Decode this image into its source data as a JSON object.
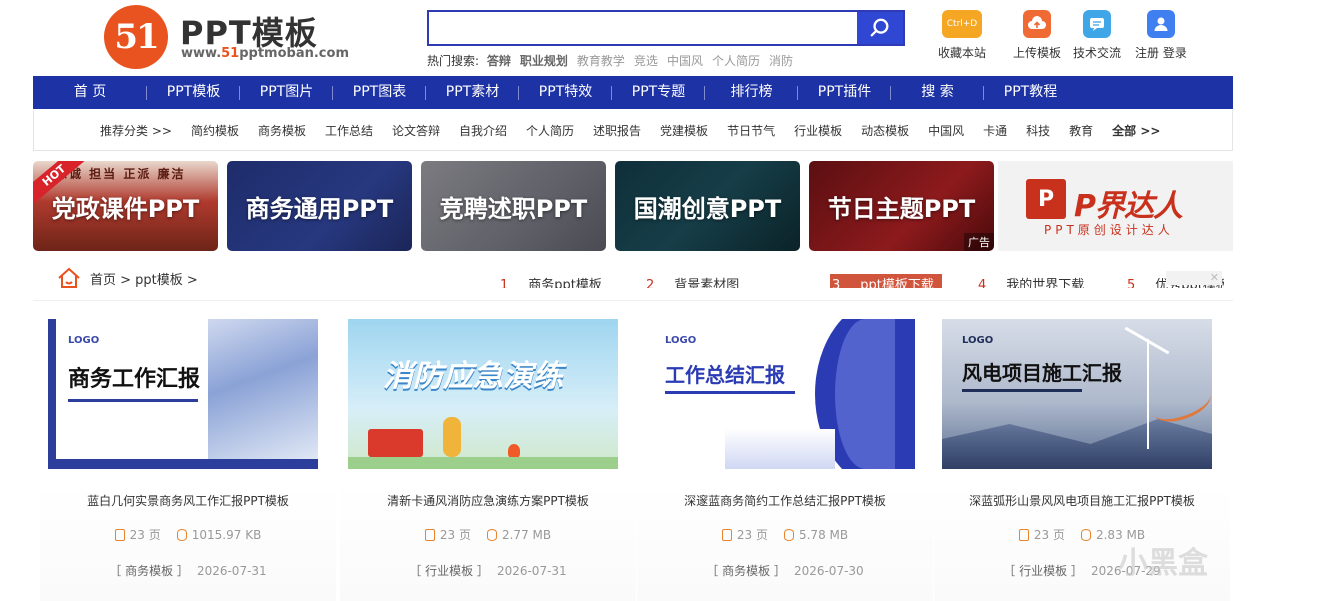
{
  "header": {
    "logo_mark": "51",
    "logo_title": "PPT模板",
    "logo_url_prefix": "www.",
    "logo_url_num": "51",
    "logo_url_suffix": "pptmoban.com",
    "search": {
      "value": "",
      "placeholder": ""
    },
    "hot_label": "热门搜索:",
    "hot_items": [
      {
        "text": "答辩",
        "bold": true
      },
      {
        "text": "职业规划",
        "bold": true
      },
      {
        "text": "教育教学",
        "bold": false
      },
      {
        "text": "竞选",
        "bold": false
      },
      {
        "text": "中国风",
        "bold": false
      },
      {
        "text": "个人简历",
        "bold": false
      },
      {
        "text": "消防",
        "bold": false
      }
    ],
    "top_icons": [
      {
        "label": "收藏本站",
        "icon": "bookmark-icon",
        "glyph": "Ctrl+D",
        "color": "#f5a623"
      },
      {
        "label": "上传模板",
        "icon": "upload-cloud-icon",
        "glyph": "",
        "color": "#f06a35"
      },
      {
        "label": "技术交流",
        "icon": "chat-icon",
        "glyph": "",
        "color": "#3fa6e8"
      },
      {
        "label": "注册 登录",
        "icon": "user-icon",
        "glyph": "",
        "color": "#3f7ff0"
      }
    ]
  },
  "nav": [
    "首 页",
    "PPT模板",
    "PPT图片",
    "PPT图表",
    "PPT素材",
    "PPT特效",
    "PPT专题",
    "排行榜",
    "PPT插件",
    "搜 索",
    "PPT教程"
  ],
  "categories": {
    "label": "推荐分类 >>",
    "items": [
      "简约模板",
      "商务模板",
      "工作总结",
      "论文答辩",
      "自我介绍",
      "个人简历",
      "述职报告",
      "党建模板",
      "节日节气",
      "行业模板",
      "动态模板",
      "中国风",
      "卡通",
      "科技",
      "教育"
    ],
    "all": "全部 >>"
  },
  "banners": [
    {
      "text": "党政课件PPT",
      "tag": "HOT",
      "bg_text": "忠诚 担当 正派 廉洁"
    },
    {
      "text": "商务通用PPT",
      "tag": "",
      "bg_text": ""
    },
    {
      "text": "竞聘述职PPT",
      "tag": "",
      "bg_text": ""
    },
    {
      "text": "国潮创意PPT",
      "tag": "",
      "bg_text": ""
    },
    {
      "text": "节日主题PPT",
      "tag": "",
      "bg_text": ""
    }
  ],
  "ad": {
    "logo": "P",
    "title": "P界达人",
    "subtitle": "PPT原创设计达人",
    "tag": "广告"
  },
  "breadcrumb": "首页 > ppt模板 >",
  "ranks": [
    {
      "num": "1",
      "text": "商务ppt模板",
      "highlight": false
    },
    {
      "num": "2",
      "text": "背景素材图",
      "highlight": false
    },
    {
      "num": "3",
      "text": "ppt模板下载",
      "highlight": true
    },
    {
      "num": "4",
      "text": "我的世界下载",
      "highlight": false
    },
    {
      "num": "5",
      "text": "优秀ppt模板",
      "highlight": false
    }
  ],
  "rank_close": "✕",
  "cards": [
    {
      "thumb_title": "商务工作汇报",
      "thumb_style": "blue-building",
      "title": "蓝白几何实景商务风工作汇报PPT模板",
      "pages": "23 页",
      "size": "1015.97 KB",
      "category": "［ 商务模板 ］",
      "date": "2026-07-31"
    },
    {
      "thumb_title": "消防应急演练",
      "thumb_style": "fire-cartoon",
      "title": "清新卡通风消防应急演练方案PPT模板",
      "pages": "23 页",
      "size": "2.77 MB",
      "category": "［ 行业模板 ］",
      "date": "2026-07-31"
    },
    {
      "thumb_title": "工作总结汇报",
      "thumb_style": "blue-wave",
      "title": "深邃蓝商务简约工作总结汇报PPT模板",
      "pages": "23 页",
      "size": "5.78 MB",
      "category": "［ 商务模板 ］",
      "date": "2026-07-30"
    },
    {
      "thumb_title": "风电项目施工汇报",
      "thumb_style": "wind-mountain",
      "title": "深蓝弧形山景风风电项目施工汇报PPT模板",
      "pages": "23 页",
      "size": "2.83 MB",
      "category": "［ 行业模板 ］",
      "date": "2026-07-29"
    }
  ],
  "watermark": "小黑盒"
}
